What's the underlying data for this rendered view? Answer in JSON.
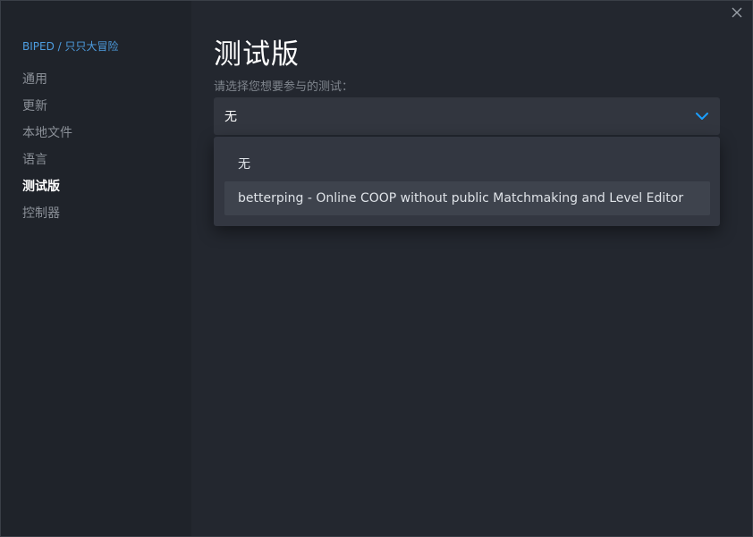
{
  "breadcrumb": "BIPED / 只只大冒险",
  "sidebar": {
    "items": [
      {
        "label": "通用"
      },
      {
        "label": "更新"
      },
      {
        "label": "本地文件"
      },
      {
        "label": "语言"
      },
      {
        "label": "测试版",
        "active": true
      },
      {
        "label": "控制器"
      }
    ]
  },
  "main": {
    "title": "测试版",
    "subtitle": "请选择您想要参与的测试：",
    "select": {
      "value": "无",
      "options": [
        "无",
        "betterping - Online COOP without public Matchmaking and Level Editor"
      ]
    }
  },
  "icons": {
    "close": "close-icon",
    "chevron": "chevron-down-icon"
  },
  "colors": {
    "accent": "#1a9fff",
    "breadcrumb": "#4d9de0"
  }
}
